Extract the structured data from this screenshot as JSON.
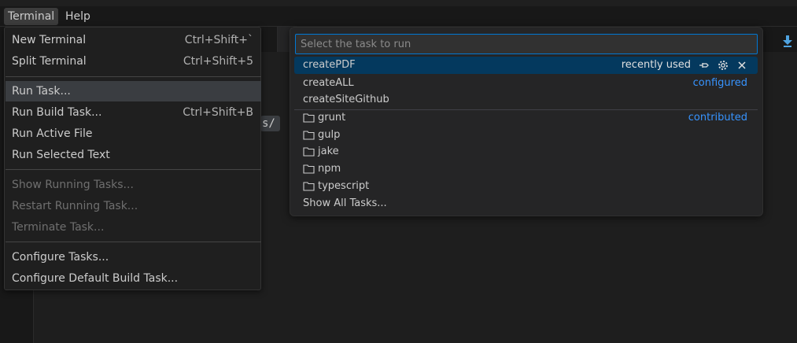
{
  "menubar": {
    "terminal": "Terminal",
    "help": "Help"
  },
  "editor": {
    "path_fragment": "s/"
  },
  "terminal_menu": {
    "items": [
      {
        "label": "New Terminal",
        "shortcut": "Ctrl+Shift+`",
        "enabled": true
      },
      {
        "label": "Split Terminal",
        "shortcut": "Ctrl+Shift+5",
        "enabled": true
      },
      {
        "label": "Run Task...",
        "shortcut": "",
        "enabled": true,
        "highlighted": true
      },
      {
        "label": "Run Build Task...",
        "shortcut": "Ctrl+Shift+B",
        "enabled": true
      },
      {
        "label": "Run Active File",
        "shortcut": "",
        "enabled": true
      },
      {
        "label": "Run Selected Text",
        "shortcut": "",
        "enabled": true
      },
      {
        "label": "Show Running Tasks...",
        "shortcut": "",
        "enabled": false
      },
      {
        "label": "Restart Running Task...",
        "shortcut": "",
        "enabled": false
      },
      {
        "label": "Terminate Task...",
        "shortcut": "",
        "enabled": false
      },
      {
        "label": "Configure Tasks...",
        "shortcut": "",
        "enabled": true
      },
      {
        "label": "Configure Default Build Task...",
        "shortcut": "",
        "enabled": true
      }
    ]
  },
  "quick_pick": {
    "placeholder": "Select the task to run",
    "items": [
      {
        "label": "createPDF",
        "tag": "recently used",
        "selected": true,
        "icon": ""
      },
      {
        "label": "createALL",
        "tag": "configured",
        "icon": ""
      },
      {
        "label": "createSiteGithub",
        "tag": "",
        "icon": ""
      },
      {
        "label": "grunt",
        "tag": "contributed",
        "icon": "folder-icon"
      },
      {
        "label": "gulp",
        "tag": "",
        "icon": "folder-icon"
      },
      {
        "label": "jake",
        "tag": "",
        "icon": "folder-icon"
      },
      {
        "label": "npm",
        "tag": "",
        "icon": "folder-icon"
      },
      {
        "label": "typescript",
        "tag": "",
        "icon": "folder-icon"
      },
      {
        "label": "Show All Tasks...",
        "tag": "",
        "icon": ""
      }
    ],
    "item_actions": [
      "pin-icon",
      "gear-icon",
      "close-icon"
    ]
  },
  "colors": {
    "accent": "#0078d4",
    "selection": "#04395e",
    "link_tag": "#3794ff"
  }
}
